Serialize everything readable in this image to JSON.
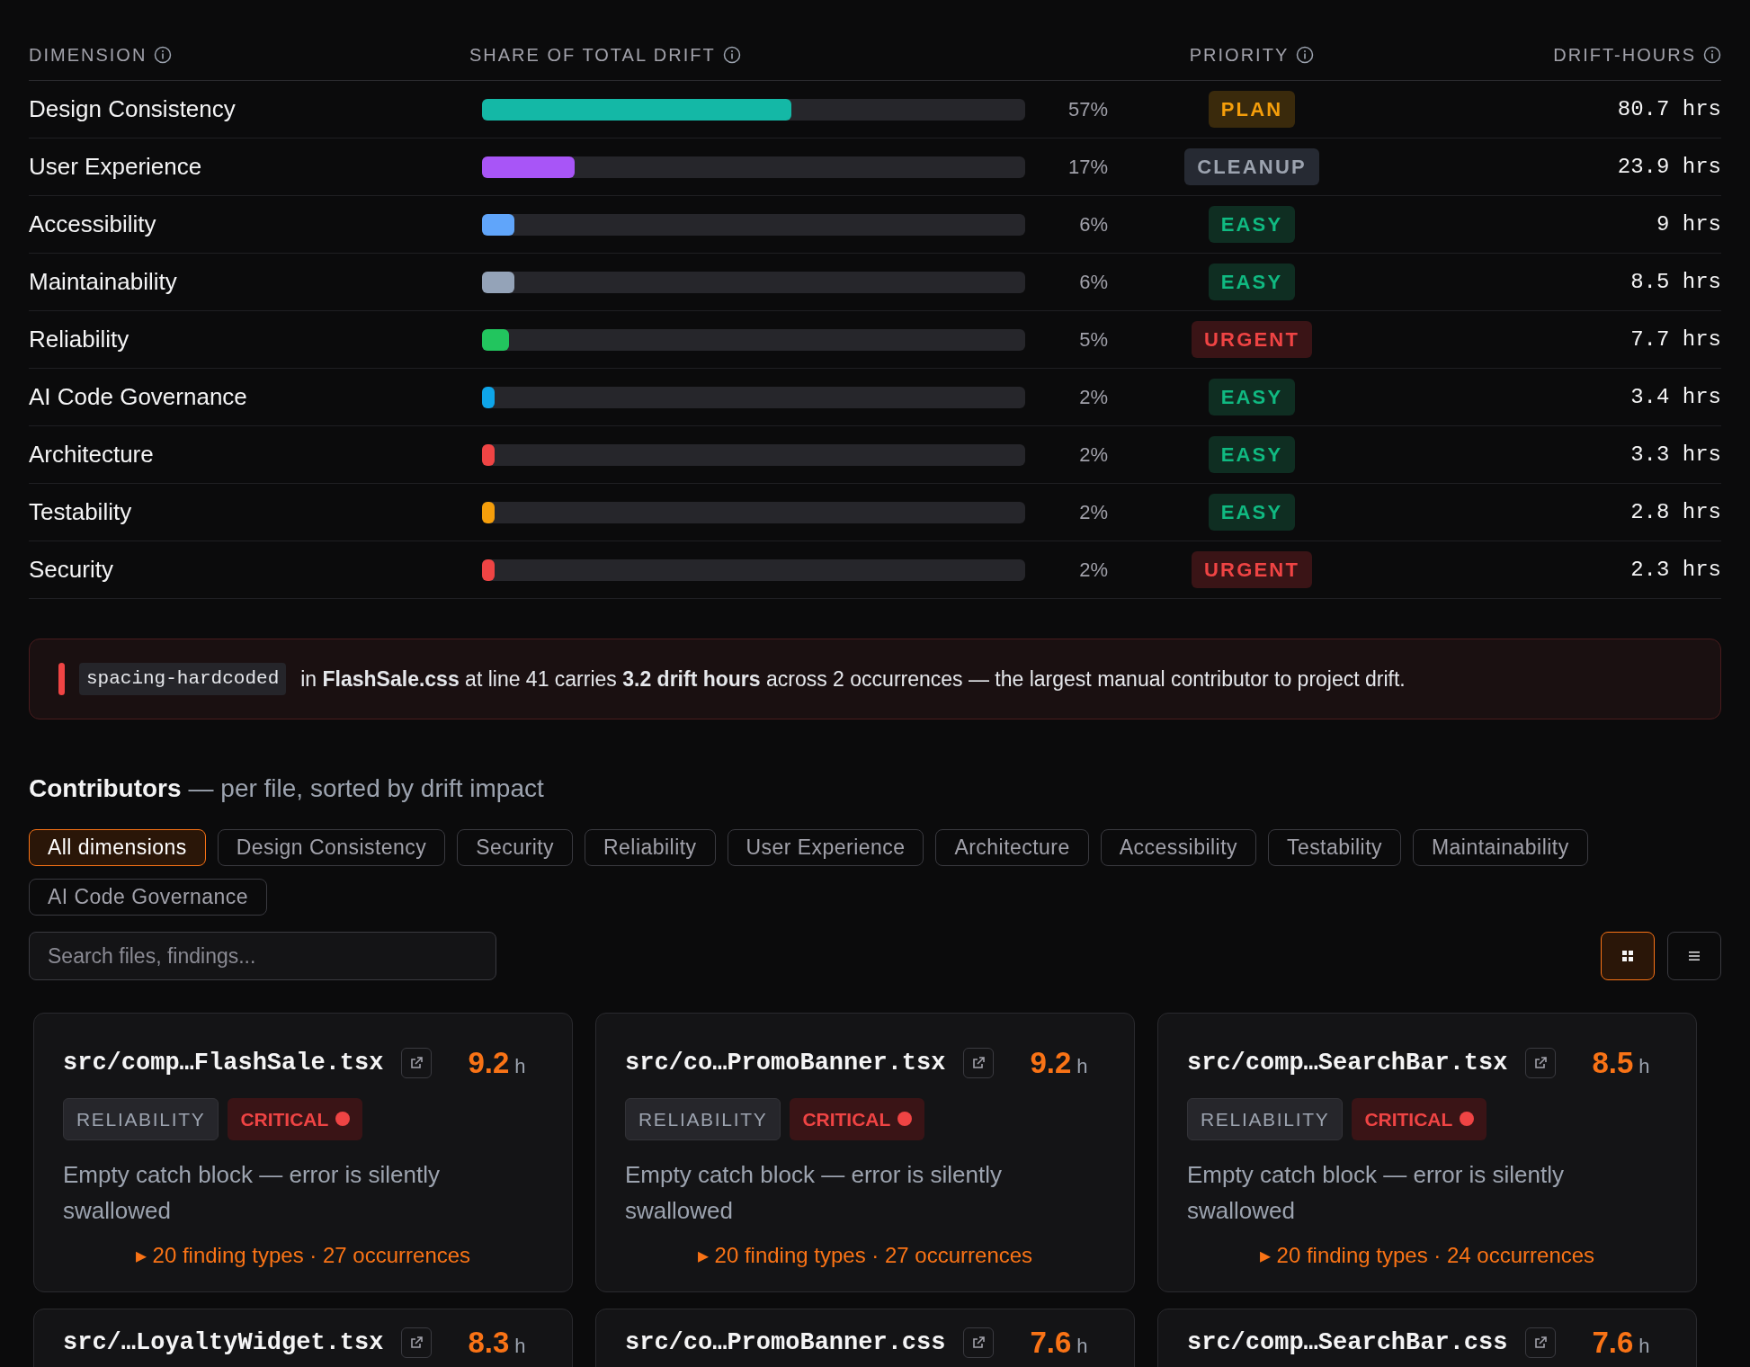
{
  "table": {
    "columns": [
      {
        "label": "DIMENSION"
      },
      {
        "label": "SHARE OF TOTAL DRIFT"
      },
      {
        "label": "PRIORITY"
      },
      {
        "label": "DRIFT-HOURS"
      }
    ],
    "rows": [
      {
        "name": "Design Consistency",
        "level": 0.57,
        "color": "#14b8a6",
        "share": "57%",
        "priority": "PLAN",
        "kind": "plan",
        "hours": "80.7 hrs"
      },
      {
        "name": "User Experience",
        "level": 0.17,
        "color": "#a855f7",
        "share": "17%",
        "priority": "CLEANUP",
        "kind": "cleanup",
        "hours": "23.9 hrs"
      },
      {
        "name": "Accessibility",
        "level": 0.06,
        "color": "#60a5fa",
        "share": "6%",
        "priority": "EASY",
        "kind": "easy",
        "hours": "9 hrs"
      },
      {
        "name": "Maintainability",
        "level": 0.06,
        "color": "#94a3b8",
        "share": "6%",
        "priority": "EASY",
        "kind": "easy",
        "hours": "8.5 hrs"
      },
      {
        "name": "Reliability",
        "level": 0.05,
        "color": "#22c55e",
        "share": "5%",
        "priority": "URGENT",
        "kind": "urgent",
        "hours": "7.7 hrs"
      },
      {
        "name": "AI Code Governance",
        "level": 0.02,
        "color": "#0ea5e9",
        "share": "2%",
        "priority": "EASY",
        "kind": "easy",
        "hours": "3.4 hrs"
      },
      {
        "name": "Architecture",
        "level": 0.02,
        "color": "#ef4444",
        "share": "2%",
        "priority": "EASY",
        "kind": "easy",
        "hours": "3.3 hrs"
      },
      {
        "name": "Testability",
        "level": 0.02,
        "color": "#f59e0b",
        "share": "2%",
        "priority": "EASY",
        "kind": "easy",
        "hours": "2.8 hrs"
      },
      {
        "name": "Security",
        "level": 0.02,
        "color": "#ef4444",
        "share": "2%",
        "priority": "URGENT",
        "kind": "urgent",
        "hours": "2.3 hrs"
      }
    ]
  },
  "alert": {
    "code": "spacing-hardcoded",
    "text": "in **FlashSale.css** at line 41 carries **3.2 drift hours** across 2 occurrences — the largest manual contributor to project drift."
  },
  "contributors": {
    "title": "Contributors",
    "subtitle": "— per file, sorted by drift impact",
    "filters": [
      {
        "label": "All dimensions",
        "selected": true
      },
      {
        "label": "Design Consistency",
        "selected": false
      },
      {
        "label": "Security",
        "selected": false
      },
      {
        "label": "Reliability",
        "selected": false
      },
      {
        "label": "User Experience",
        "selected": false
      },
      {
        "label": "Architecture",
        "selected": false
      },
      {
        "label": "Accessibility",
        "selected": false
      },
      {
        "label": "Testability",
        "selected": false
      },
      {
        "label": "Maintainability",
        "selected": false
      },
      {
        "label": "AI Code Governance",
        "selected": false
      }
    ],
    "search": {
      "placeholder": "Search files, findings..."
    },
    "views": [
      {
        "kind": "grid",
        "selected": true
      },
      {
        "kind": "list",
        "selected": false
      }
    ],
    "cards": [
      {
        "path": "src/comp…FlashSale.tsx",
        "hours": "9.2",
        "unit": "h",
        "category": "RELIABILITY",
        "severity": "CRITICAL",
        "description": "Empty catch block — error is silently swallowed",
        "footer": "▸ 20 finding types · 27 occurrences"
      },
      {
        "path": "src/co…PromoBanner.tsx",
        "hours": "9.2",
        "unit": "h",
        "category": "RELIABILITY",
        "severity": "CRITICAL",
        "description": "Empty catch block — error is silently swallowed",
        "footer": "▸ 20 finding types · 27 occurrences"
      },
      {
        "path": "src/comp…SearchBar.tsx",
        "hours": "8.5",
        "unit": "h",
        "category": "RELIABILITY",
        "severity": "CRITICAL",
        "description": "Empty catch block — error is silently swallowed",
        "footer": "▸ 20 finding types · 24 occurrences"
      },
      {
        "path": "src/…LoyaltyWidget.tsx",
        "hours": "8.3",
        "unit": "h"
      },
      {
        "path": "src/co…PromoBanner.css",
        "hours": "7.6",
        "unit": "h"
      },
      {
        "path": "src/comp…SearchBar.css",
        "hours": "7.6",
        "unit": "h"
      }
    ]
  }
}
